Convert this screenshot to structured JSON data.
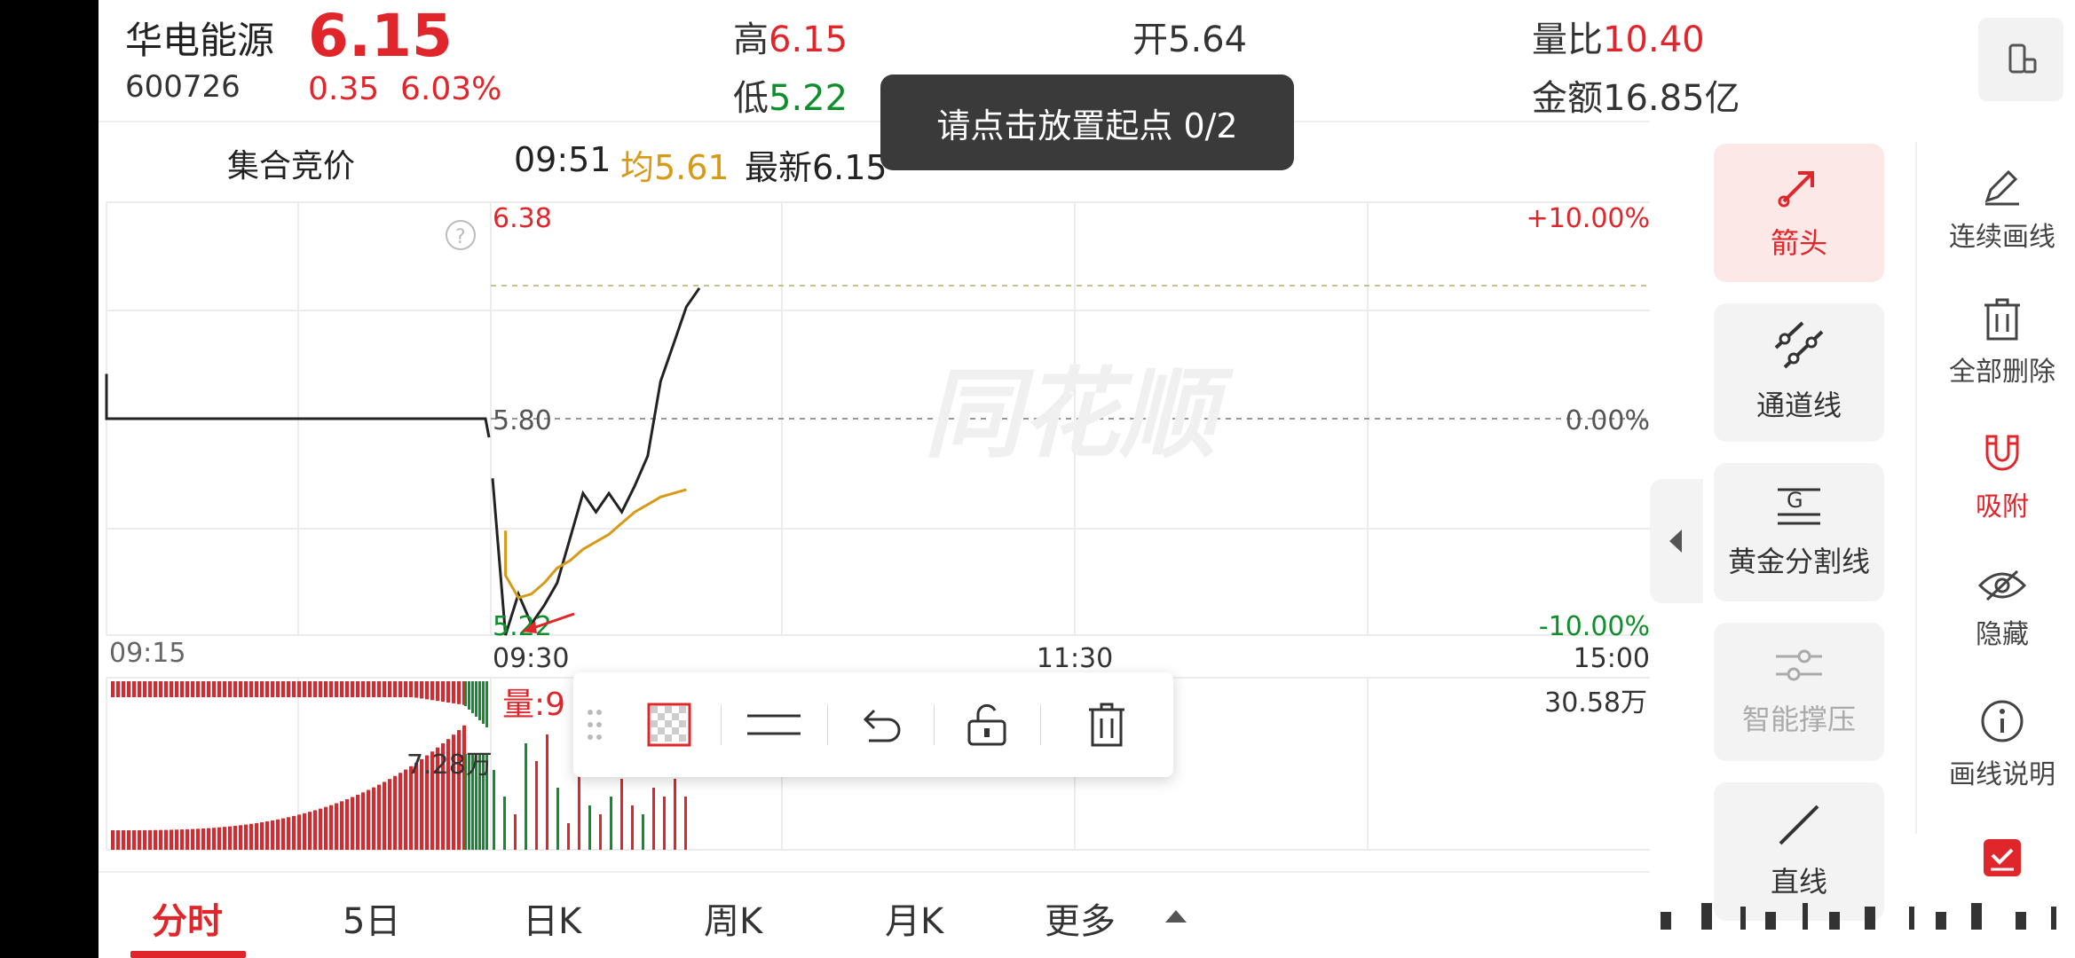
{
  "header": {
    "name": "华电能源",
    "code": "600726",
    "price": "6.15",
    "change": "0.35",
    "change_pct": "6.03%",
    "high_label": "高",
    "high_value": "6.15",
    "low_label": "低",
    "low_value": "5.22",
    "open_label": "开",
    "open_value": "5.64",
    "volume_ratio_label": "量比",
    "volume_ratio_value": "10.40",
    "amount_label": "金额",
    "amount_value": "16.85亿"
  },
  "toast": {
    "text": "请点击放置起点 0/2"
  },
  "subheader": {
    "auction_label": "集合竞价",
    "time": "09:51",
    "avg_label": "均5.61",
    "latest_label": "最新6.15"
  },
  "chart_data": {
    "type": "line",
    "x_ticks": [
      "09:15",
      "09:30",
      "11:30",
      "15:00"
    ],
    "y_ticks": [
      "6.38",
      "5.80",
      "5.22"
    ],
    "pct_ticks": [
      "+10.00%",
      "0.00%",
      "-10.00%"
    ],
    "ylim": [
      5.22,
      6.38
    ],
    "prev_close": 5.8,
    "volume_max_label": "30.58万",
    "auction_volume_label": "7.28万",
    "volume_label": "量:9",
    "auction_series": {
      "name": "",
      "values": [
        5.92,
        5.8,
        5.8,
        5.8,
        5.8,
        5.75
      ]
    },
    "price_series": {
      "name": "",
      "values": [
        5.64,
        5.22,
        5.33,
        5.25,
        5.3,
        5.36,
        5.48,
        5.6,
        5.55,
        5.6,
        5.55,
        5.62,
        5.7,
        5.9,
        6.0,
        6.1,
        6.15
      ]
    },
    "avg_series": {
      "name": "",
      "values": [
        5.64,
        5.5,
        5.38,
        5.32,
        5.33,
        5.36,
        5.4,
        5.42,
        5.45,
        5.47,
        5.49,
        5.52,
        5.55,
        5.57,
        5.59,
        5.6,
        5.61
      ]
    },
    "watermark": "同花顺",
    "colors": {
      "up": "#e0252b",
      "down": "#0e8f2c",
      "avg": "#d89a16",
      "price": "#222222"
    }
  },
  "draw_toolbar": {
    "items": [
      "drag-handle-icon",
      "fill-pattern-icon",
      "line-style-icon",
      "undo-icon",
      "unlock-icon",
      "delete-icon"
    ]
  },
  "tools": {
    "cards": [
      {
        "label": "箭头",
        "icon": "arrow-icon"
      },
      {
        "label": "通道线",
        "icon": "channel-line-icon"
      },
      {
        "label": "黄金分割线",
        "icon": "golden-ratio-icon"
      },
      {
        "label": "智能撑压",
        "icon": "support-pressure-icon"
      },
      {
        "label": "直线",
        "icon": "straight-line-icon"
      }
    ],
    "side": [
      {
        "label": "连续画线",
        "icon": "pencil-icon"
      },
      {
        "label": "全部删除",
        "icon": "trash-icon"
      },
      {
        "label": "吸附",
        "icon": "magnet-icon"
      },
      {
        "label": "隐藏",
        "icon": "eye-icon"
      },
      {
        "label": "画线说明",
        "icon": "info-icon"
      },
      {
        "label": "",
        "icon": "checkbox-icon"
      }
    ]
  },
  "tabs": [
    {
      "label": "分时"
    },
    {
      "label": "5日"
    },
    {
      "label": "日K"
    },
    {
      "label": "周K"
    },
    {
      "label": "月K"
    },
    {
      "label": "更多"
    }
  ]
}
